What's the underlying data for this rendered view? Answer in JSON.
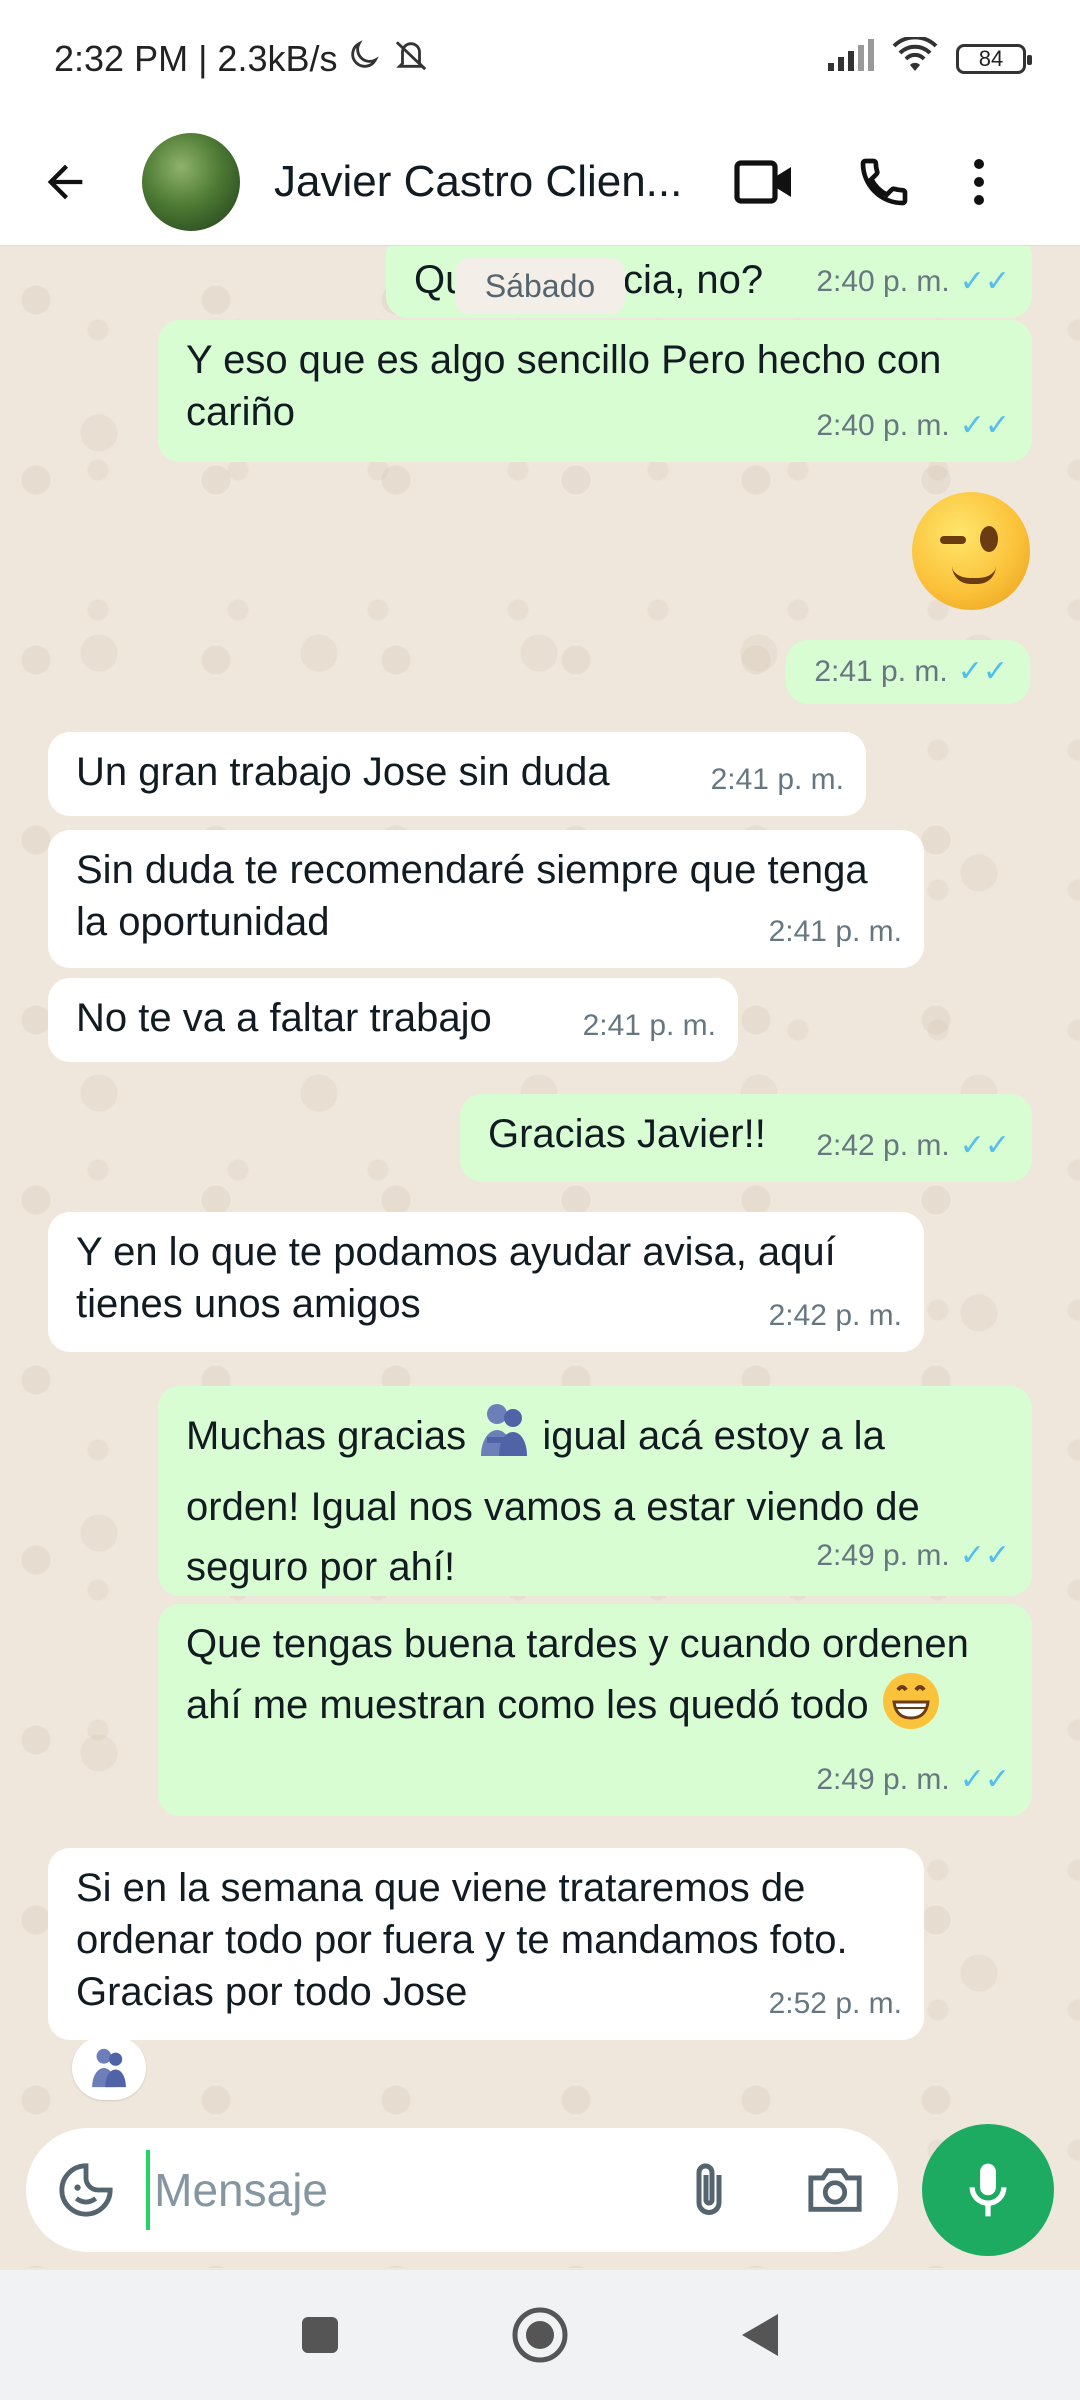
{
  "status_bar": {
    "time_speed": "2:32 PM | 2.3kB/s",
    "battery": "84",
    "icons": [
      "moon-icon",
      "mute-icon",
      "signal-icon",
      "wifi-icon",
      "battery-icon"
    ]
  },
  "header": {
    "contact_name": "Javier Castro Clien...",
    "icons": [
      "back-arrow-icon",
      "avatar",
      "video-call-icon",
      "phone-icon",
      "more-vert-icon"
    ]
  },
  "chat": {
    "date_chip": "Sábado",
    "messages": [
      {
        "dir": "out",
        "text": "Que diferencia, no?",
        "time": "2:40 p. m.",
        "ticks": "✓✓"
      },
      {
        "dir": "out",
        "text": "Y eso que es algo sencillo Pero hecho con cariño",
        "time": "2:40 p. m.",
        "ticks": "✓✓"
      },
      {
        "dir": "out",
        "text": "",
        "emoji": "winking-face",
        "time": "2:41 p. m.",
        "ticks": "✓✓"
      },
      {
        "dir": "in",
        "text": "Un gran trabajo Jose sin duda",
        "time": "2:41 p. m."
      },
      {
        "dir": "in",
        "text": "Sin duda te recomendaré siempre que tenga la oportunidad",
        "time": "2:41 p. m."
      },
      {
        "dir": "in",
        "text": "No te va a faltar trabajo",
        "time": "2:41 p. m."
      },
      {
        "dir": "out",
        "text": "Gracias Javier!!",
        "time": "2:42 p. m.",
        "ticks": "✓✓"
      },
      {
        "dir": "in",
        "text": "Y en lo que te podamos ayudar avisa, aquí tienes unos amigos",
        "time": "2:42 p. m."
      },
      {
        "dir": "out",
        "text_before": "Muchas gracias",
        "text_after": "igual acá estoy a la orden! Igual nos vamos a estar viendo de seguro por ahí!",
        "emoji": "people-hugging",
        "time": "2:49 p. m.",
        "ticks": "✓✓"
      },
      {
        "dir": "out",
        "text": "Que tengas buena tardes y cuando ordenen ahí me muestran como les quedó todo",
        "emoji": "grinning-face",
        "time": "2:49 p. m.",
        "ticks": "✓✓"
      },
      {
        "dir": "in",
        "text": "Si en la semana que viene trataremos de ordenar todo por fuera y te mandamos foto. Gracias por todo Jose",
        "time": "2:52 p. m.",
        "reaction": "people-hugging"
      }
    ]
  },
  "composer": {
    "placeholder": "Mensaje",
    "value": ""
  },
  "colors": {
    "outgoing_bubble": "#d9fdd3",
    "incoming_bubble": "#ffffff",
    "chat_background": "#efe7dc",
    "accent_green": "#1daa61",
    "read_ticks": "#53bdeb"
  }
}
